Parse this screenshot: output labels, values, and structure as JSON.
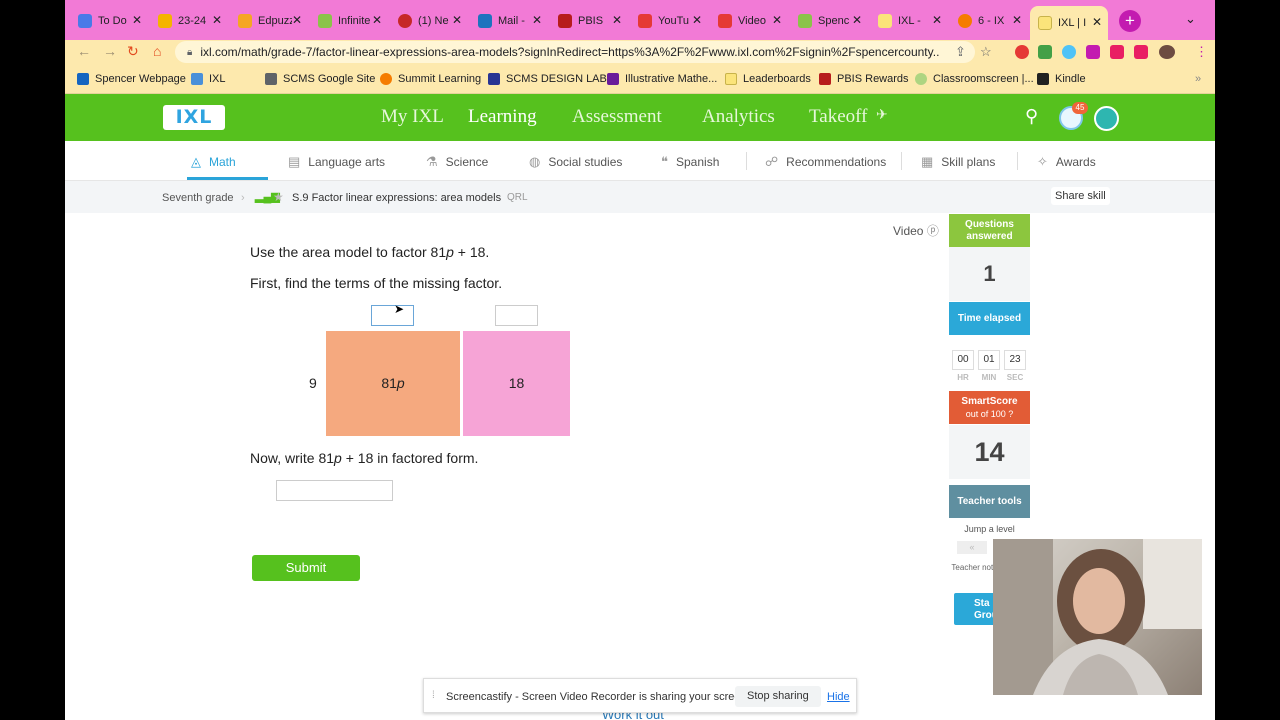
{
  "browser": {
    "tabs": [
      {
        "title": "To Do",
        "color": "#4a7ae8"
      },
      {
        "title": "23-24",
        "color": "#f4b400"
      },
      {
        "title": "Edpuzzle",
        "color": "#f5a623"
      },
      {
        "title": "Infinite",
        "color": "#8bc34a"
      },
      {
        "title": "(1) Ne",
        "color": "#c62828"
      },
      {
        "title": "Mail -",
        "color": "#1e73be"
      },
      {
        "title": "PBIS",
        "color": "#b71c1c"
      },
      {
        "title": "YouTu",
        "color": "#e53935"
      },
      {
        "title": "Video",
        "color": "#e53935"
      },
      {
        "title": "Spenc",
        "color": "#8bc34a"
      },
      {
        "title": "IXL -",
        "color": "#fbe47a"
      },
      {
        "title": "6 - IX",
        "color": "#f57c00"
      },
      {
        "title": "IXL | I",
        "color": "#fbe47a"
      }
    ],
    "new_tab": "+",
    "tab_menu": "⌄",
    "url": "ixl.com/math/grade-7/factor-linear-expressions-area-models?signInRedirect=https%3A%2F%2Fwww.ixl.com%2Fsignin%2Fspencercounty...",
    "bookmarks": [
      {
        "label": "Spencer Webpage",
        "color": "#1565c0"
      },
      {
        "label": "IXL",
        "color": "#4a90d9"
      },
      {
        "label": "SCMS Google Site",
        "color": "#5f6368"
      },
      {
        "label": "Summit Learning",
        "color": "#f57c00"
      },
      {
        "label": "SCMS DESIGN LAB",
        "color": "#283593"
      },
      {
        "label": "Illustrative Mathe...",
        "color": "#6a1b9a"
      },
      {
        "label": "Leaderboards",
        "color": "#fbe47a"
      },
      {
        "label": "PBIS Rewards",
        "color": "#b71c1c"
      },
      {
        "label": "Classroomscreen |...",
        "color": "#aed581"
      },
      {
        "label": "Kindle",
        "color": "#212121"
      }
    ],
    "bookmarks_more": "»"
  },
  "ixl": {
    "logo": "IXL",
    "nav": [
      "My IXL",
      "Learning",
      "Assessment",
      "Analytics",
      "Takeoff"
    ],
    "notification_count": "45",
    "subjects": [
      "Math",
      "Language arts",
      "Science",
      "Social studies",
      "Spanish",
      "Recommendations",
      "Skill plans",
      "Awards"
    ],
    "breadcrumb": {
      "grade": "Seventh grade",
      "skill": "S.9 Factor linear expressions: area models",
      "code": "QRL"
    },
    "share_skill": "Share skill"
  },
  "question": {
    "video": "Video",
    "prompt_pre": "Use the area model to factor 81",
    "prompt_var": "p",
    "prompt_post": " + 18.",
    "step1": "First, find the terms of the missing factor.",
    "row_factor": "9",
    "area_left_num": "81",
    "area_left_var": "p",
    "area_right": "18",
    "step2_pre": "Now, write 81",
    "step2_var": "p",
    "step2_post": " + 18 in factored form.",
    "submit": "Submit",
    "work_it_out": "Work it out"
  },
  "sidebar": {
    "questions_answered_label": "Questions answered",
    "questions_answered": "1",
    "time_elapsed_label": "Time elapsed",
    "time": {
      "hr": "00",
      "min": "01",
      "sec": "23"
    },
    "time_labels": {
      "hr": "HR",
      "min": "MIN",
      "sec": "SEC"
    },
    "smartscore_label": "SmartScore",
    "smartscore_sub": "out of 100",
    "smartscore": "14",
    "teacher_tools_label": "Teacher tools",
    "jump_label": "Jump a level",
    "jump_arrows": "«",
    "teacher_note": "Teacher not rec",
    "start_group": "Sta Group"
  },
  "screencastify": {
    "message": "Screencastify - Screen Video Recorder is sharing your screen.",
    "stop": "Stop sharing",
    "hide": "Hide"
  }
}
